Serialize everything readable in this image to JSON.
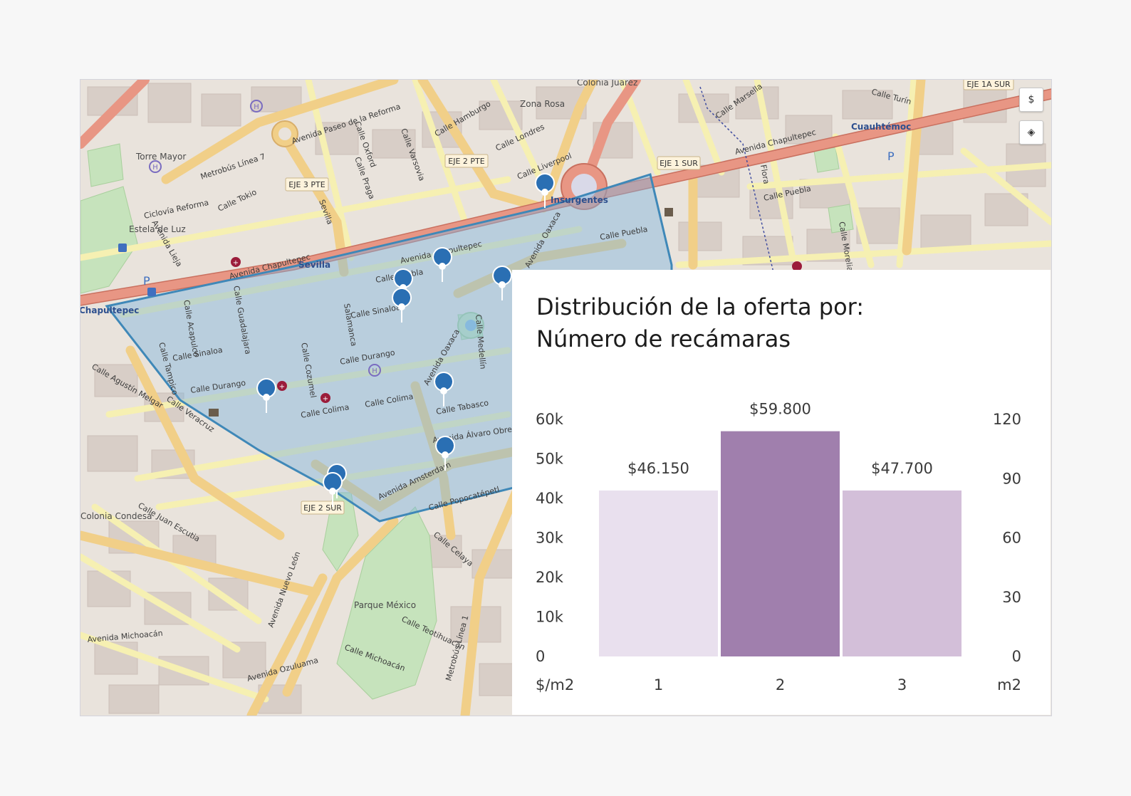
{
  "map": {
    "icon_names": [
      "map-pin-icon",
      "currency-icon",
      "layers-icon",
      "hospital-icon",
      "parking-icon",
      "bus-icon",
      "museum-icon"
    ],
    "labels": {
      "colonia_juarez": "Colonia Juárez",
      "zona_rosa": "Zona Rosa",
      "cuauhtemoc": "Cuauhtémoc",
      "insurgentes": "Insurgentes",
      "sevilla": "Sevilla",
      "chapultepec": "Chapultepec",
      "colonia_condesa": "Colonia Condesa",
      "parque_mexico": "Parque México",
      "torre_mayor": "Torre Mayor",
      "estela_de_luz": "Estela de Luz",
      "paseo_reforma": "Avenida Paseo de la Reforma",
      "av_chapultepec": "Avenida Chapultepec",
      "av_oaxaca": "Avenida Oaxaca",
      "av_amsterdam": "Avenida Amsterdam",
      "av_nuevo_leon": "Avenida Nuevo León",
      "av_veracruz": "Calle Veracruz",
      "av_alvaro_obregon": "Avenida Álvaro Obregón",
      "calle_durango": "Calle Durango",
      "calle_colima": "Calle Colima",
      "calle_puebla": "Calle Puebla",
      "calle_sinaloa": "Calle Sinaloa",
      "calle_liverpool": "Calle Liverpool",
      "calle_londres": "Calle Londres",
      "calle_hamburgo": "Calle Hamburgo",
      "calle_tokio": "Calle Tokio",
      "calle_michoacan": "Calle Michoacán",
      "av_michoacan": "Avenida Michoacán",
      "calle_tabasco": "Calle Tabasco",
      "calle_juan_escutia": "Calle Juan Escutia",
      "av_ozuluama": "Avenida Ozuluama",
      "calle_teotihuacan": "Calle Teotihuacán",
      "calle_medellin": "Calle Medellín",
      "calle_salamanca": "Salamanca",
      "calle_cozumel": "Calle Cozumel",
      "calle_guadalajara": "Calle Guadalajara",
      "calle_marsella": "Calle Marsella",
      "calle_turin": "Calle Turín",
      "ciclovia_reforma": "Ciclovía Reforma",
      "metrobus_l7": "Metrobús Línea 7",
      "metrobus_l1": "Metrobús Línea 1",
      "calle_varsovia": "Calle Varsovia",
      "calle_praga": "Calle Praga",
      "calle_oxford": "Calle Oxford",
      "av_lieja": "Avenida Lieja",
      "calle_agustin": "Calle Agustín Melgar",
      "calle_celaya": "Calle Celaya",
      "calle_popocatepetl": "Calle Popocatépetl",
      "calle_acapulco": "Calle Acapulco",
      "calle_tampico": "Calle Tampico",
      "calle_morelia": "Calle Morelia",
      "calle_flora": "Flora",
      "calle_insurgentes_sevilla": "Sevilla"
    },
    "shields": {
      "eje3pte": "EJE 3 PTE",
      "eje2pte": "EJE 2 PTE",
      "eje1sur": "EJE 1 SUR",
      "eje2sur": "EJE 2 SUR",
      "eje1asur": "EJE 1A SUR"
    },
    "controls": {
      "currency_symbol": "$",
      "layers_symbol": "◈"
    },
    "colors": {
      "land": "#e8e3dc",
      "block": "#d9d0c9",
      "polygon_fill": "#7fb3dd",
      "polygon_stroke": "#3f88b8",
      "pin": "#2a6fb3",
      "park": "#c8e6c0",
      "main_road": "#e89b8c",
      "secondary_road": "#f4d58d",
      "tertiary_road": "#f8f3b8"
    }
  },
  "chart": {
    "title_line1": "Distribución de la oferta por:",
    "title_line2": "Número de recámaras",
    "left_axis_unit": "$/m2",
    "right_axis_unit": "m2"
  },
  "chart_data": {
    "type": "bar",
    "title": "Distribución de la oferta por: Número de recámaras",
    "xlabel": "",
    "categories": [
      "1",
      "2",
      "3"
    ],
    "series": [
      {
        "values": [
          84,
          114,
          84
        ],
        "colors": [
          "#e9e0ee",
          "#a07fad",
          "#d3bfd9"
        ]
      }
    ],
    "data_labels": [
      "$46.150",
      "$59.800",
      "$47.700"
    ],
    "left_axis": {
      "label": "$/m2",
      "ticks": [
        "0",
        "10k",
        "20k",
        "30k",
        "40k",
        "50k",
        "60k"
      ],
      "ylim": [
        0,
        60000
      ]
    },
    "right_axis": {
      "label": "m2",
      "ticks": [
        "0",
        "30",
        "60",
        "90",
        "120"
      ],
      "ylim": [
        0,
        120
      ]
    },
    "grid": false,
    "legend": "none"
  }
}
